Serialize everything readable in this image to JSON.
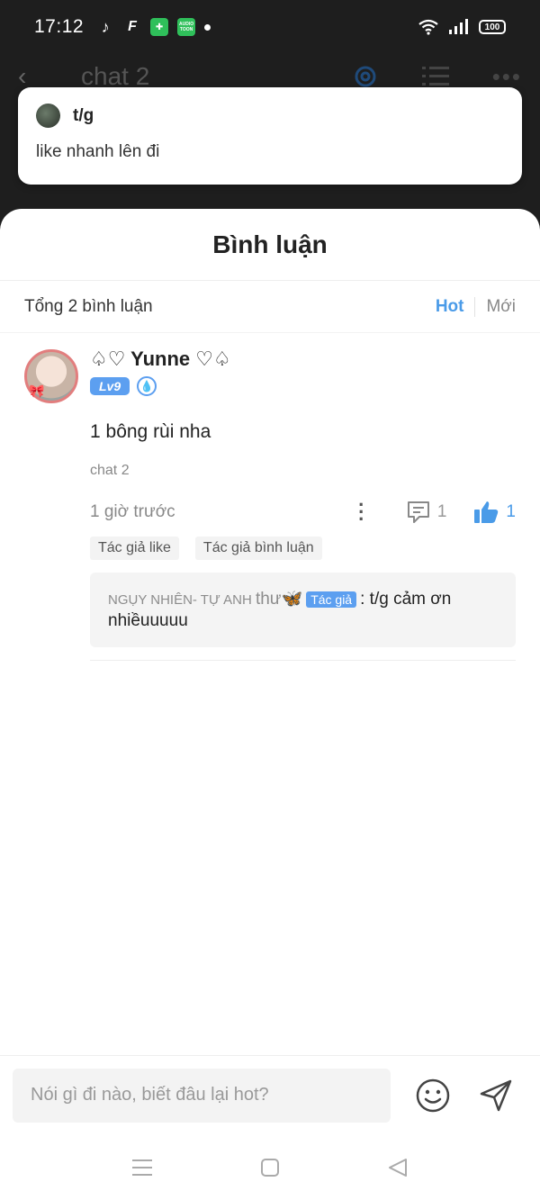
{
  "status_bar": {
    "time": "17:12",
    "battery": "100",
    "app_badge": "AUDIO TOON"
  },
  "background_header": {
    "title": "chat 2"
  },
  "notification": {
    "user": "t/g",
    "message": "like nhanh lên đi"
  },
  "sheet": {
    "title": "Bình luận",
    "total": "Tổng 2 bình luận",
    "sort_tabs": [
      "Hot",
      "Mới"
    ]
  },
  "comment": {
    "username": "♤♡ Yunne ♡♤",
    "level": "Lv9",
    "text": "1 bông rùi nha",
    "chapter": "chat 2",
    "time": "1 giờ trước",
    "reply_count": "1",
    "like_count": "1",
    "tags": [
      "Tác giả like",
      "Tác giả bình luận"
    ],
    "reply": {
      "author": "NGỤY NHIÊN- TỰ ANH",
      "author_suffix": "thư🦋",
      "author_tag": "Tác giả",
      "text": ": t/g cảm ơn nhiềuuuuu"
    }
  },
  "input": {
    "placeholder": "Nói gì đi nào, biết đâu lại hot?"
  },
  "colors": {
    "accent": "#4a9be8",
    "sheet_bg": "#ffffff",
    "overlay_bg": "#1e1e1e"
  }
}
